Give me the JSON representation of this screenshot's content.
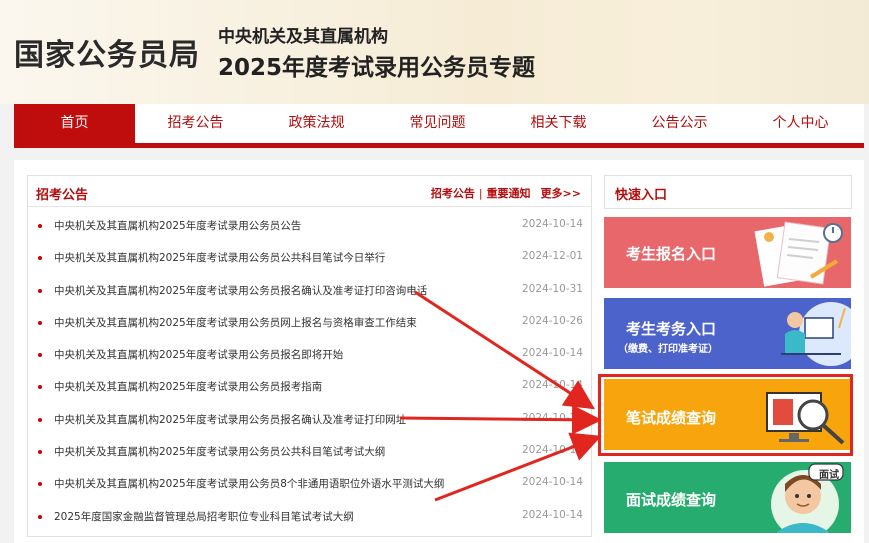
{
  "header": {
    "site_title": "国家公务员局",
    "subtitle_line1": "中央机关及其直属机构",
    "subtitle_line2": "2025年度考试录用公务员专题"
  },
  "nav": {
    "items": [
      {
        "label": "首页",
        "active": true
      },
      {
        "label": "招考公告",
        "active": false
      },
      {
        "label": "政策法规",
        "active": false
      },
      {
        "label": "常见问题",
        "active": false
      },
      {
        "label": "相关下载",
        "active": false
      },
      {
        "label": "公告公示",
        "active": false
      },
      {
        "label": "个人中心",
        "active": false
      }
    ]
  },
  "notices": {
    "title": "招考公告",
    "link1": "招考公告",
    "separator": "|",
    "link2": "重要通知",
    "more": "更多>>",
    "items": [
      {
        "title": "中央机关及其直属机构2025年度考试录用公务员公告",
        "date": "2024-10-14"
      },
      {
        "title": "中央机关及其直属机构2025年度考试录用公务员公共科目笔试今日举行",
        "date": "2024-12-01"
      },
      {
        "title": "中央机关及其直属机构2025年度考试录用公务员报名确认及准考证打印咨询电话",
        "date": "2024-10-31"
      },
      {
        "title": "中央机关及其直属机构2025年度考试录用公务员网上报名与资格审查工作结束",
        "date": "2024-10-26"
      },
      {
        "title": "中央机关及其直属机构2025年度考试录用公务员报名即将开始",
        "date": "2024-10-14"
      },
      {
        "title": "中央机关及其直属机构2025年度考试录用公务员报考指南",
        "date": "2024-10-14"
      },
      {
        "title": "中央机关及其直属机构2025年度考试录用公务员报名确认及准考证打印网址",
        "date": "2024-10-25"
      },
      {
        "title": "中央机关及其直属机构2025年度考试录用公务员公共科目笔试考试大纲",
        "date": "2024-10-14"
      },
      {
        "title": "中央机关及其直属机构2025年度考试录用公务员8个非通用语职位外语水平测试大纲",
        "date": "2024-10-14"
      },
      {
        "title": "2025年度国家金融监督管理总局招考职位专业科目笔试考试大纲",
        "date": "2024-10-14"
      }
    ]
  },
  "quick": {
    "title": "快速入口",
    "btn1": "考生报名入口",
    "btn2": "考生考务入口",
    "btn2_sub": "（缴费、打印准考证）",
    "btn3": "笔试成绩查询",
    "btn4": "面试成绩查询",
    "bubble": "面试"
  },
  "colors": {
    "brand_red": "#bf0c0c",
    "btn1": "#e8676b",
    "btn2": "#4d63cc",
    "btn3": "#f8a40d",
    "btn4": "#25ac6e",
    "annotation": "#e0261f"
  }
}
